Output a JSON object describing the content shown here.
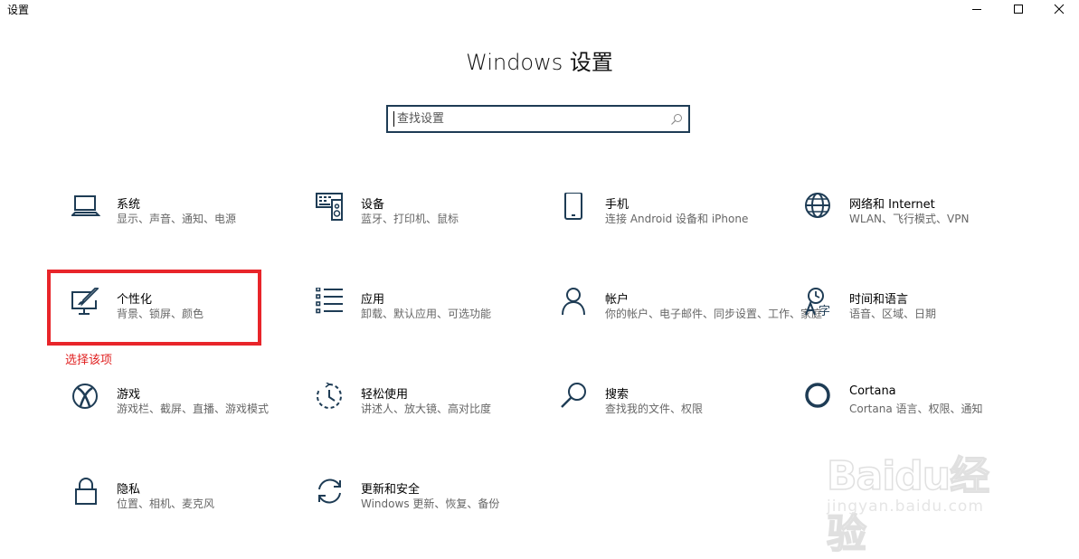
{
  "window": {
    "title": "设置"
  },
  "heading": "Windows 设置",
  "search": {
    "placeholder": "查找设置",
    "value": ""
  },
  "tiles": [
    {
      "title": "系统",
      "desc": "显示、声音、通知、电源",
      "icon": "laptop-icon"
    },
    {
      "title": "设备",
      "desc": "蓝牙、打印机、鼠标",
      "icon": "devices-icon"
    },
    {
      "title": "手机",
      "desc": "连接 Android 设备和 iPhone",
      "icon": "phone-icon"
    },
    {
      "title": "网络和 Internet",
      "desc": "WLAN、飞行模式、VPN",
      "icon": "globe-icon"
    },
    {
      "title": "个性化",
      "desc": "背景、锁屏、颜色",
      "icon": "personalization-icon"
    },
    {
      "title": "应用",
      "desc": "卸载、默认应用、可选功能",
      "icon": "apps-list-icon"
    },
    {
      "title": "帐户",
      "desc": "你的帐户、电子邮件、同步设置、工作、家庭",
      "icon": "person-icon"
    },
    {
      "title": "时间和语言",
      "desc": "语音、区域、日期",
      "icon": "time-language-icon"
    },
    {
      "title": "游戏",
      "desc": "游戏栏、截屏、直播、游戏模式",
      "icon": "xbox-icon"
    },
    {
      "title": "轻松使用",
      "desc": "讲述人、放大镜、高对比度",
      "icon": "ease-of-access-icon"
    },
    {
      "title": "搜索",
      "desc": "查找我的文件、权限",
      "icon": "magnifier-icon"
    },
    {
      "title": "Cortana",
      "desc": "Cortana 语言、权限、通知",
      "icon": "cortana-icon"
    },
    {
      "title": "隐私",
      "desc": "位置、相机、麦克风",
      "icon": "lock-icon"
    },
    {
      "title": "更新和安全",
      "desc": "Windows 更新、恢复、备份",
      "icon": "sync-icon"
    }
  ],
  "annotation": "选择该项",
  "watermark": {
    "brand": "Baidu经验",
    "url": "jingyan.baidu.com"
  }
}
